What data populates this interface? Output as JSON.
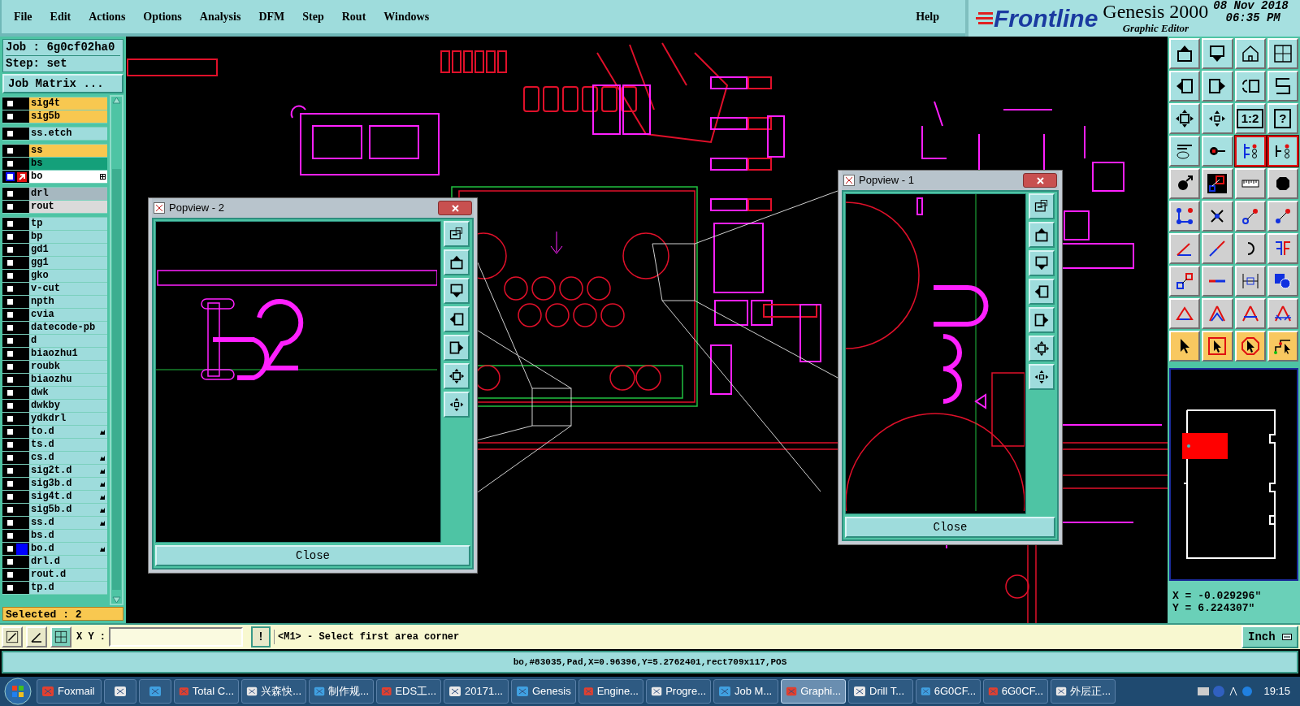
{
  "menu_bar": {
    "items": [
      "File",
      "Edit",
      "Actions",
      "Options",
      "Analysis",
      "DFM",
      "Step",
      "Rout",
      "Windows"
    ],
    "help": "Help"
  },
  "header": {
    "brand": "Frontline",
    "product": "Genesis 2000",
    "subtitle": "Graphic Editor",
    "date": "08 Nov 2018",
    "time": "06:35 PM"
  },
  "job_panel": {
    "job": "Job : 6g0cf02ha0",
    "step": "Step: set",
    "matrix_button": "Job Matrix ...",
    "selected_count": "Selected : 2",
    "layer_groups": [
      [
        {
          "name": "sig4t",
          "color": "#f8c850",
          "checked": false,
          "marked": false,
          "work": false
        },
        {
          "name": "sig5b",
          "color": "#f8c850",
          "checked": false,
          "marked": false,
          "work": false
        }
      ],
      [
        {
          "name": "ss.etch",
          "color": "#9edcdc",
          "checked": false,
          "marked": false,
          "work": false
        }
      ],
      [
        {
          "name": "ss",
          "color": "#f8c850",
          "checked": false,
          "marked": false,
          "work": false
        },
        {
          "name": "bs",
          "color": "#14a07a",
          "checked": false,
          "marked": false,
          "work": false
        },
        {
          "name": "bo",
          "color": "#ffffff",
          "checked": false,
          "marked": false,
          "work": true
        }
      ],
      [
        {
          "name": "drl",
          "color": "#a6b8c0",
          "checked": false,
          "marked": false,
          "work": false
        },
        {
          "name": "rout",
          "color": "#dadada",
          "checked": false,
          "marked": false,
          "work": false
        }
      ],
      [
        {
          "name": "tp",
          "color": "#9edcdc",
          "checked": false,
          "marked": false,
          "work": false
        },
        {
          "name": "bp",
          "color": "#9edcdc",
          "checked": false,
          "marked": false,
          "work": false
        },
        {
          "name": "gd1",
          "color": "#9edcdc",
          "checked": false,
          "marked": false,
          "work": false
        },
        {
          "name": "gg1",
          "color": "#9edcdc",
          "checked": false,
          "marked": false,
          "work": false
        },
        {
          "name": "gko",
          "color": "#9edcdc",
          "checked": false,
          "marked": false,
          "work": false
        },
        {
          "name": "v-cut",
          "color": "#9edcdc",
          "checked": false,
          "marked": false,
          "work": false
        },
        {
          "name": "npth",
          "color": "#9edcdc",
          "checked": false,
          "marked": false,
          "work": false
        },
        {
          "name": "cvia",
          "color": "#9edcdc",
          "checked": false,
          "marked": false,
          "work": false
        },
        {
          "name": "datecode-pb",
          "color": "#9edcdc",
          "checked": false,
          "marked": false,
          "work": false
        },
        {
          "name": "d",
          "color": "#9edcdc",
          "checked": false,
          "marked": false,
          "work": false
        },
        {
          "name": "biaozhu1",
          "color": "#9edcdc",
          "checked": false,
          "marked": false,
          "work": false
        },
        {
          "name": "roubk",
          "color": "#9edcdc",
          "checked": false,
          "marked": false,
          "work": false
        },
        {
          "name": "biaozhu",
          "color": "#9edcdc",
          "checked": false,
          "marked": false,
          "work": false
        },
        {
          "name": "dwk",
          "color": "#9edcdc",
          "checked": false,
          "marked": false,
          "work": false
        },
        {
          "name": "dwkby",
          "color": "#9edcdc",
          "checked": false,
          "marked": false,
          "work": false
        },
        {
          "name": "ydkdrl",
          "color": "#9edcdc",
          "checked": false,
          "marked": false,
          "work": false
        },
        {
          "name": "to.d",
          "color": "#9edcdc",
          "checked": false,
          "marked": true,
          "work": false
        },
        {
          "name": "ts.d",
          "color": "#9edcdc",
          "checked": false,
          "marked": false,
          "work": false
        },
        {
          "name": "cs.d",
          "color": "#9edcdc",
          "checked": false,
          "marked": true,
          "work": false
        },
        {
          "name": "sig2t.d",
          "color": "#9edcdc",
          "checked": false,
          "marked": true,
          "work": false
        },
        {
          "name": "sig3b.d",
          "color": "#9edcdc",
          "checked": false,
          "marked": true,
          "work": false
        },
        {
          "name": "sig4t.d",
          "color": "#9edcdc",
          "checked": false,
          "marked": true,
          "work": false
        },
        {
          "name": "sig5b.d",
          "color": "#9edcdc",
          "checked": false,
          "marked": true,
          "work": false
        },
        {
          "name": "ss.d",
          "color": "#9edcdc",
          "checked": false,
          "marked": true,
          "work": false
        },
        {
          "name": "bs.d",
          "color": "#9edcdc",
          "checked": false,
          "marked": false,
          "work": false
        },
        {
          "name": "bo.d",
          "color": "#9edcdc",
          "checked": false,
          "marked": true,
          "work": false,
          "tag": {
            "color": "#0000ff"
          }
        },
        {
          "name": "drl.d",
          "color": "#9edcdc",
          "checked": false,
          "marked": false,
          "work": false
        },
        {
          "name": "rout.d",
          "color": "#9edcdc",
          "checked": false,
          "marked": false,
          "work": false
        },
        {
          "name": "tp.d",
          "color": "#9edcdc",
          "checked": false,
          "marked": false,
          "work": false
        }
      ]
    ]
  },
  "popviews": [
    {
      "title": "Popview - 2",
      "close_button": "Close",
      "kind": "wide"
    },
    {
      "title": "Popview - 1",
      "close_button": "Close",
      "kind": "narrow"
    }
  ],
  "toolbar": [
    {
      "on": false
    },
    {
      "on": false
    },
    {
      "on": false
    },
    {
      "on": false
    },
    {
      "on": false
    },
    {
      "on": false
    },
    {
      "on": false
    },
    {
      "on": false
    },
    {
      "on": false
    },
    {
      "on": false
    },
    {
      "on": false,
      "label": "1:2"
    },
    {
      "on": false,
      "label": "?"
    },
    {
      "on": false
    },
    {
      "on": false
    },
    {
      "on": true
    },
    {
      "on": true
    },
    {
      "on": false
    },
    {
      "on": false
    },
    {
      "on": false
    },
    {
      "on": false
    },
    {
      "on": false
    },
    {
      "on": false
    },
    {
      "on": false
    },
    {
      "on": false
    },
    {
      "on": false
    },
    {
      "on": false
    },
    {
      "on": false
    },
    {
      "on": false
    },
    {
      "on": false
    },
    {
      "on": false
    },
    {
      "on": false
    },
    {
      "on": false
    },
    {
      "on": false
    },
    {
      "on": false
    },
    {
      "on": false
    },
    {
      "on": false
    },
    {
      "on": false
    },
    {
      "on": false
    },
    {
      "on": false
    },
    {
      "on": false
    }
  ],
  "overview": {
    "x": "X = -0.029296\"",
    "y": "Y = 6.224307\""
  },
  "command_bar": {
    "xy_label": "X Y :",
    "alert_button": "!",
    "prompt": "<M1> - Select first area corner",
    "units": "Inch"
  },
  "status_line": "bo,#83035,Pad,X=0.96396,Y=5.2762401,rect709x117,POS",
  "taskbar": {
    "items": [
      {
        "label": "Foxmail",
        "selected": false
      },
      {
        "selected": false
      },
      {
        "selected": false
      },
      {
        "label": "Total C...",
        "selected": false
      },
      {
        "label": "兴森快...",
        "selected": false
      },
      {
        "label": "制作规...",
        "selected": false
      },
      {
        "label": "EDS工...",
        "selected": false
      },
      {
        "label": "20171...",
        "selected": false
      },
      {
        "label": "Genesis",
        "selected": false
      },
      {
        "label": "Engine...",
        "selected": false
      },
      {
        "label": "Progre...",
        "selected": false
      },
      {
        "label": "Job M...",
        "selected": false
      },
      {
        "label": "Graphi...",
        "selected": true
      },
      {
        "label": "Drill T...",
        "selected": false
      },
      {
        "label": "6G0CF...",
        "selected": false
      },
      {
        "label": "6G0CF...",
        "selected": false
      },
      {
        "label": "外层正...",
        "selected": false
      }
    ],
    "clock": "19:15"
  }
}
